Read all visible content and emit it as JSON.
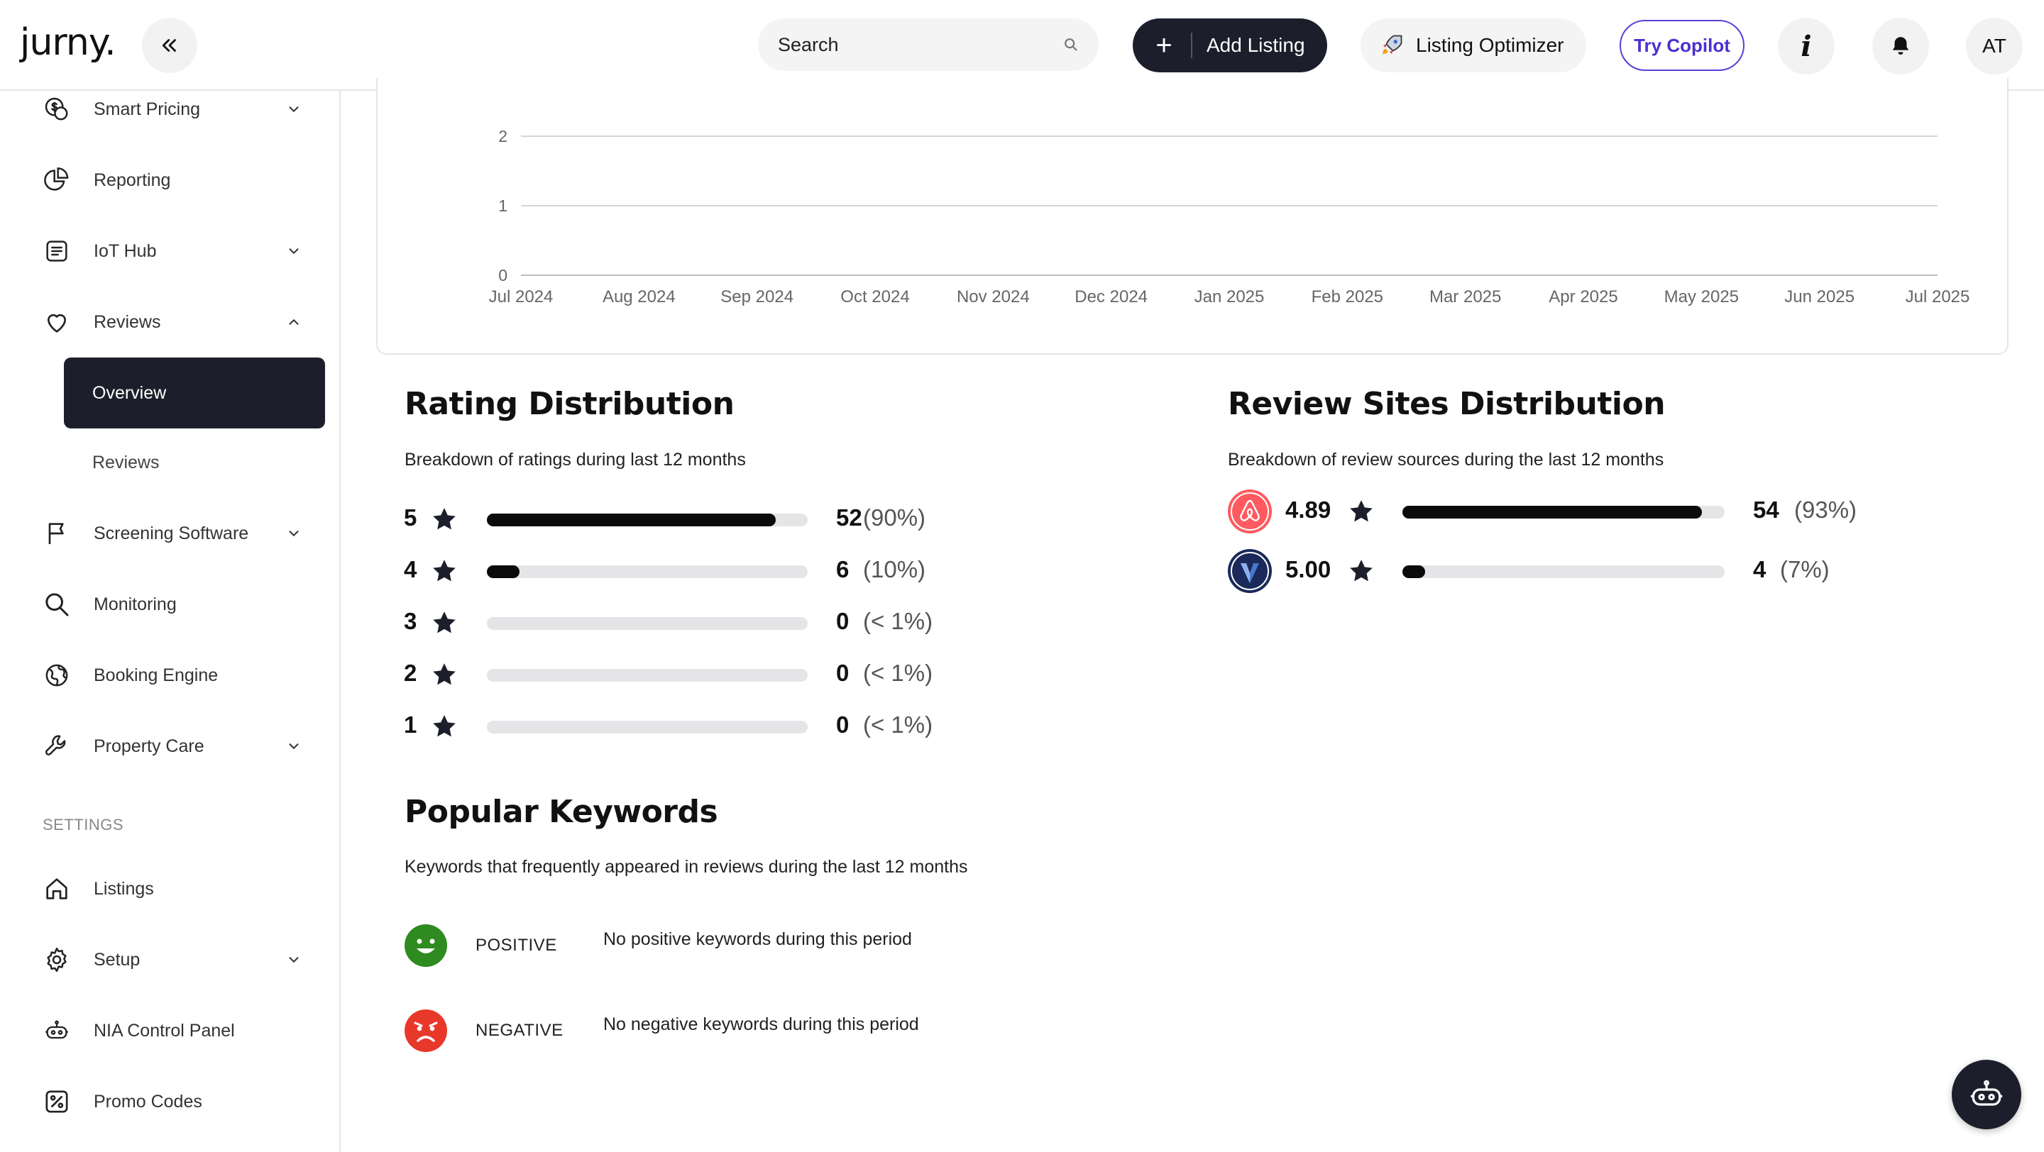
{
  "header": {
    "logo": "jurny.",
    "search_placeholder": "Search",
    "add_listing": "Add Listing",
    "listing_optimizer": "Listing Optimizer",
    "try_copilot": "Try Copilot",
    "avatar_initials": "AT"
  },
  "sidebar": {
    "items": [
      {
        "label": "Smart Pricing",
        "icon": "dollar-circle-icon"
      },
      {
        "label": "Reporting",
        "icon": "pie-chart-icon"
      },
      {
        "label": "IoT Hub",
        "icon": "iot-device-icon"
      },
      {
        "label": "Reviews",
        "icon": "heart-icon"
      },
      {
        "label": "Screening Software",
        "icon": "flag-icon"
      },
      {
        "label": "Monitoring",
        "icon": "magnifier-icon"
      },
      {
        "label": "Booking Engine",
        "icon": "globe-icon"
      },
      {
        "label": "Property Care",
        "icon": "wrench-icon"
      }
    ],
    "reviews_sub": {
      "active": "Overview",
      "other": "Reviews"
    },
    "settings_label": "SETTINGS",
    "settings_items": [
      {
        "label": "Listings",
        "icon": "home-icon"
      },
      {
        "label": "Setup",
        "icon": "gear-icon"
      },
      {
        "label": "NIA Control Panel",
        "icon": "robot-icon"
      },
      {
        "label": "Promo Codes",
        "icon": "percent-tag-icon"
      }
    ]
  },
  "chart_data": {
    "type": "line",
    "x": [
      "Jul 2024",
      "Aug 2024",
      "Sep 2024",
      "Oct 2024",
      "Nov 2024",
      "Dec 2024",
      "Jan 2025",
      "Feb 2025",
      "Mar 2025",
      "Apr 2025",
      "May 2025",
      "Jun 2025",
      "Jul 2025"
    ],
    "y_ticks": [
      "0",
      "1",
      "2"
    ],
    "ylim": [
      0,
      2
    ],
    "grid": true
  },
  "rating": {
    "title": "Rating Distribution",
    "subtitle": "Breakdown of ratings during last 12 months",
    "rows": [
      {
        "stars": "5",
        "count": "52",
        "pct": "(90%)",
        "fraction": 0.9
      },
      {
        "stars": "4",
        "count": "6",
        "pct": "(10%)",
        "fraction": 0.1
      },
      {
        "stars": "3",
        "count": "0",
        "pct": "(< 1%)",
        "fraction": 0
      },
      {
        "stars": "2",
        "count": "0",
        "pct": "(< 1%)",
        "fraction": 0
      },
      {
        "stars": "1",
        "count": "0",
        "pct": "(< 1%)",
        "fraction": 0
      }
    ]
  },
  "sites": {
    "title": "Review Sites Distribution",
    "subtitle": "Breakdown of review sources during the last 12 months",
    "rows": [
      {
        "site_icon": "airbnb-logo-icon",
        "rating": "4.89",
        "count": "54",
        "pct": "(93%)",
        "fraction": 0.93,
        "color": "#ff5a5f"
      },
      {
        "site_icon": "vrbo-logo-icon",
        "rating": "5.00",
        "count": "4",
        "pct": "(7%)",
        "fraction": 0.07,
        "color": "#1b2a5a"
      }
    ]
  },
  "keywords": {
    "title": "Popular Keywords",
    "subtitle": "Keywords that frequently appeared in reviews during the last 12 months",
    "positive_label": "POSITIVE",
    "positive_text": "No positive keywords during this period",
    "negative_label": "NEGATIVE",
    "negative_text": "No negative keywords during this period",
    "positive_color": "#2e8b1f",
    "negative_color": "#e8382a"
  }
}
